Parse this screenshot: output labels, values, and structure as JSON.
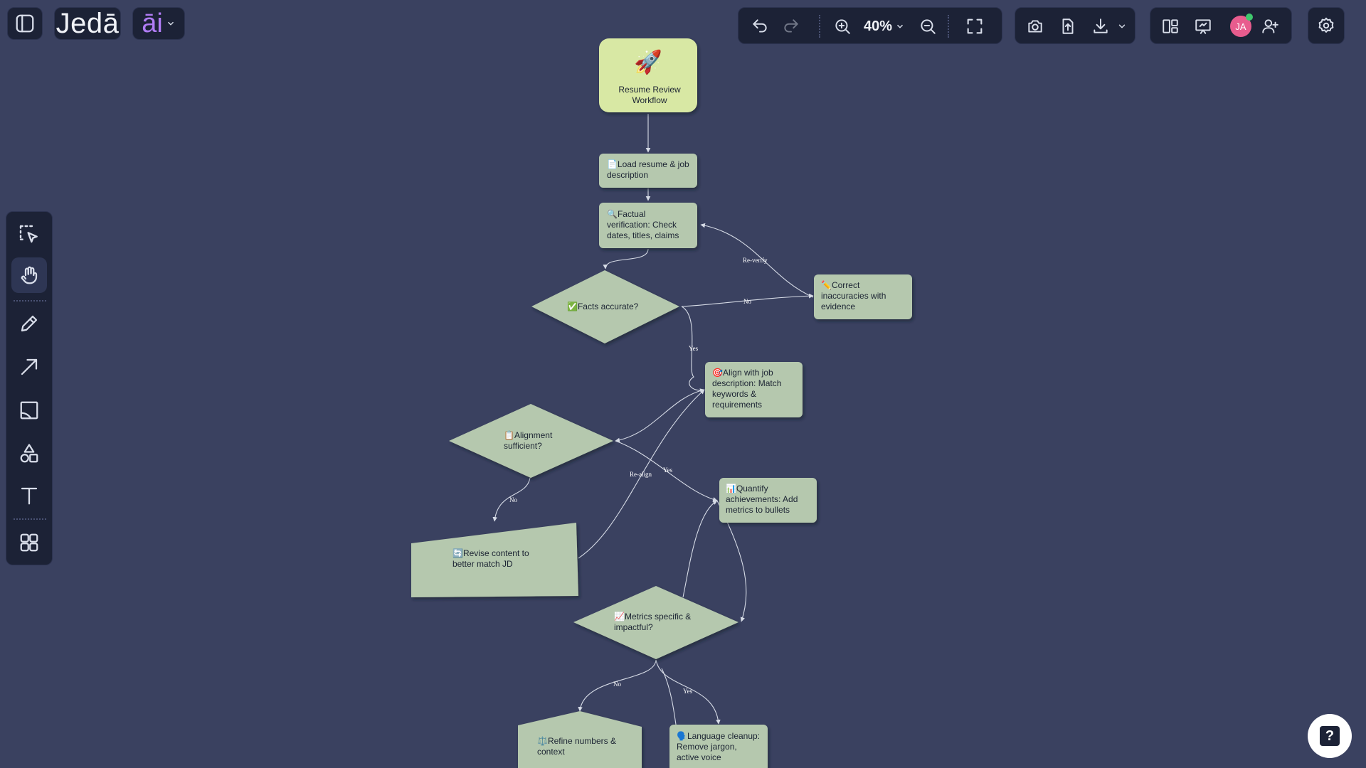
{
  "app": {
    "logo": "Jedā",
    "ai_label": "āi",
    "colors": {
      "background": "#3a4160",
      "node_fill": "#b5c8ae",
      "start_fill": "#d8e8a4",
      "panel": "#1c2236",
      "ai_accent": "#b07cf5",
      "avatar": "#e85c8e"
    }
  },
  "toolbar": {
    "zoom_level": "40%",
    "avatar_initials": "JA",
    "icons": [
      "sidebar-toggle-icon",
      "undo-icon",
      "redo-icon",
      "zoom-in-icon",
      "zoom-out-icon",
      "fullscreen-icon",
      "camera-icon",
      "upload-icon",
      "download-icon",
      "layout-icon",
      "present-icon",
      "add-user-icon",
      "gear-icon"
    ]
  },
  "tools": [
    "select-tool-icon",
    "hand-tool-icon",
    "pencil-tool-icon",
    "arrow-tool-icon",
    "image-tool-icon",
    "shapes-tool-icon",
    "text-tool-icon",
    "components-tool-icon"
  ],
  "help_label": "?",
  "flow": {
    "start": {
      "emoji": "🚀",
      "line1": "Resume Review",
      "line2": "Workflow"
    },
    "load": {
      "line1": "📄Load resume & job",
      "line2": "description"
    },
    "factual": {
      "line1": "🔍Factual",
      "line2": "verification: Check",
      "line3": "dates, titles, claims"
    },
    "facts_q": {
      "line1": "✅Facts accurate?"
    },
    "correct": {
      "line1": "✏️Correct",
      "line2": "inaccuracies with",
      "line3": "evidence"
    },
    "align": {
      "line1": "🎯Align with job",
      "line2": "description: Match",
      "line3": "keywords &",
      "line4": "requirements"
    },
    "align_q": {
      "line1": "📋Alignment",
      "line2": "sufficient?"
    },
    "revise": {
      "line1": "🔄Revise content to",
      "line2": "better match JD"
    },
    "quantify": {
      "line1": "📊Quantify",
      "line2": "achievements: Add",
      "line3": "metrics to bullets"
    },
    "metrics_q": {
      "line1": "📈Metrics specific &",
      "line2": "impactful?"
    },
    "refine": {
      "line1": "⚖️Refine numbers &",
      "line2": "context"
    },
    "language": {
      "line1": "🗣️Language cleanup:",
      "line2": "Remove jargon,",
      "line3": "active voice"
    },
    "edges": {
      "reverify": "Re-verify",
      "no1": "No",
      "yes1": "Yes",
      "realign": "Re-align",
      "yes2": "Yes",
      "no2": "No",
      "no3": "No",
      "yes3": "Yes"
    }
  }
}
